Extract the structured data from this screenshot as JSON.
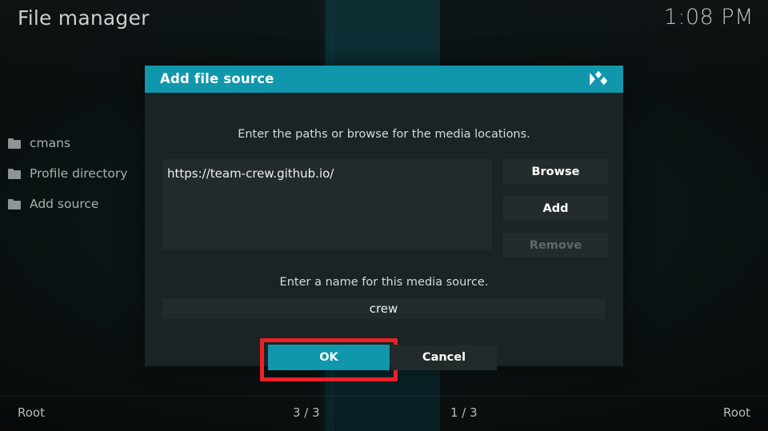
{
  "colors": {
    "accent_teal": "#1197ab",
    "highlight_red": "#ea2229",
    "dialog_bg": "#1b2424",
    "field_bg": "#222b2b",
    "screen_bg": "#080a0a"
  },
  "header": {
    "title": "File manager",
    "clock": "1:08 PM"
  },
  "sidebar": {
    "items": [
      {
        "icon": "folder-icon",
        "label": "cmans"
      },
      {
        "icon": "folder-icon",
        "label": "Profile directory"
      },
      {
        "icon": "folder-icon",
        "label": "Add source"
      }
    ]
  },
  "dialog": {
    "title": "Add file source",
    "logo_icon": "kodi-logo-icon",
    "paths_hint": "Enter the paths or browse for the media locations.",
    "path_value": "https://team-crew.github.io/",
    "buttons": {
      "browse": "Browse",
      "add": "Add",
      "remove": "Remove"
    },
    "name_hint": "Enter a name for this media source.",
    "name_value": "crew",
    "ok": "OK",
    "cancel": "Cancel"
  },
  "statusbar": {
    "left": "Root",
    "middle_left": "3 / 3",
    "middle_right": "1 / 3",
    "right": "Root"
  }
}
